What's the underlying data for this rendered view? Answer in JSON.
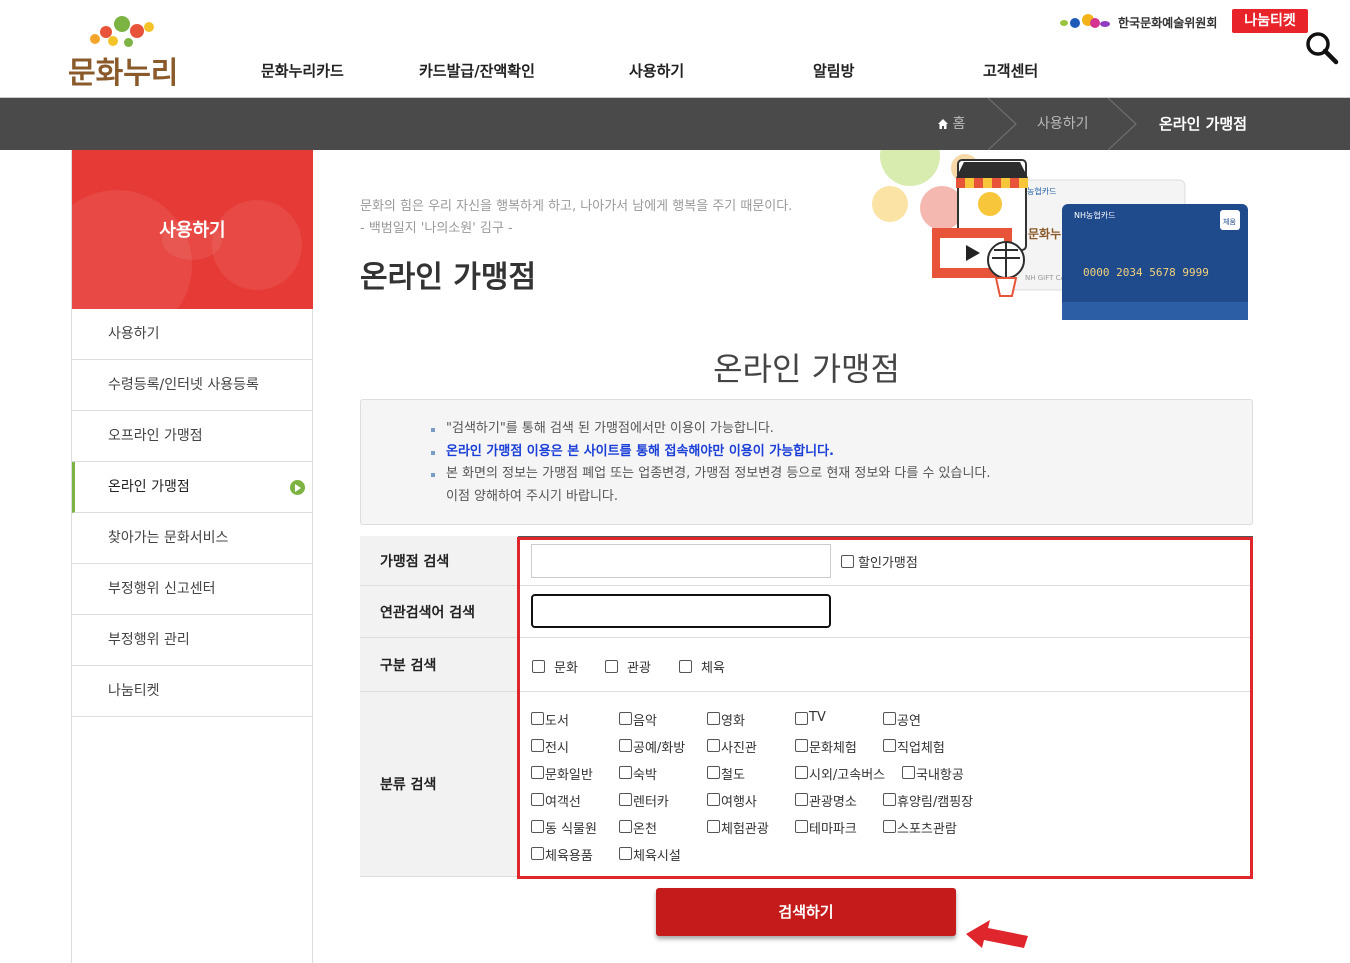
{
  "header": {
    "logo_text": "문화누리",
    "nav": [
      "문화누리카드",
      "카드발급/잔액확인",
      "사용하기",
      "알림방",
      "고객센터"
    ],
    "org_label": "한국문화예술위원회",
    "nanum_label": "나눔티켓"
  },
  "breadcrumb": {
    "home": "홈",
    "level1": "사용하기",
    "current": "온라인 가맹점"
  },
  "sidebar": {
    "title": "사용하기",
    "items": [
      {
        "label": "사용하기"
      },
      {
        "label": "수령등록/인터넷 사용등록"
      },
      {
        "label": "오프라인 가맹점"
      },
      {
        "label": "온라인 가맹점"
      },
      {
        "label": "찾아가는 문화서비스"
      },
      {
        "label": "부정행위 신고센터"
      },
      {
        "label": "부정행위 관리"
      },
      {
        "label": "나눔티켓"
      }
    ]
  },
  "content": {
    "quote_line1": "문화의 힘은 우리 자신을 행복하게 하고, 나아가서 남에게 행복을 주기 때문이다.",
    "quote_line2": "- 백범일지 '나의소원' 김구 -",
    "page_title": "온라인 가맹점",
    "section_title": "온라인 가맹점",
    "hero": {
      "card_brand": "NH농협카드",
      "card_number": "0000 2034 5678 9999",
      "card_badge": "체움",
      "card_back_text": "NH GIFT CA"
    }
  },
  "notice": [
    "\"검색하기\"를 통해 검색 된 가맹점에서만 이용이 가능합니다.",
    "온라인 가맹점 이용은 본 사이트를 통해 접속해야만 이용이 가능합니다.",
    "본 화면의 정보는 가맹점 폐업 또는 업종변경, 가맹점 정보변경 등으로 현재 정보와 다를 수 있습니다.",
    "이점 양해하여 주시기 바랍니다."
  ],
  "form": {
    "store_search_label": "가맹점 검색",
    "store_search_value": "",
    "discount_label": "할인가맹점",
    "related_label": "연관검색어 검색",
    "related_value": "",
    "type_label": "구분 검색",
    "types": [
      "문화",
      "관광",
      "체육"
    ],
    "category_label": "분류 검색",
    "categories": [
      [
        "도서",
        "음악",
        "영화",
        "TV",
        "공연"
      ],
      [
        "전시",
        "공예/화방",
        "사진관",
        "문화체험",
        "직업체험"
      ],
      [
        "문화일반",
        "숙박",
        "철도",
        "시외/고속버스",
        "국내항공"
      ],
      [
        "여객선",
        "렌터카",
        "여행사",
        "관광명소",
        "휴양림/캠핑장"
      ],
      [
        "동 식물원",
        "온천",
        "체험관광",
        "테마파크",
        "스포츠관람"
      ],
      [
        "체육용품",
        "체육시설"
      ]
    ],
    "submit_label": "검색하기"
  },
  "colors": {
    "brand_red": "#e63a36",
    "button_red": "#c51b1b",
    "highlight_border": "#e0262d",
    "active_green": "#7cb342",
    "notice_blue": "#1a3fd8"
  }
}
